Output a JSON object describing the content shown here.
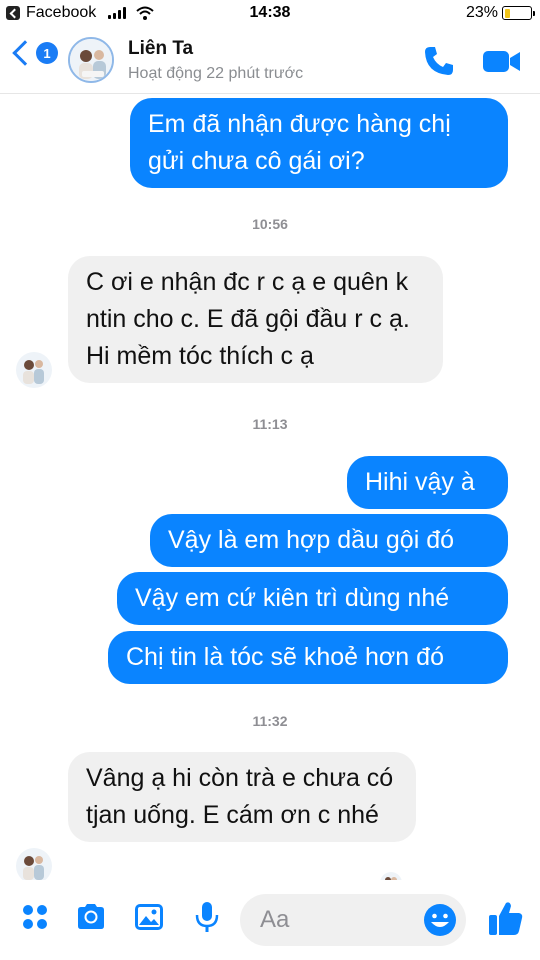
{
  "status_bar": {
    "back_app": "Facebook",
    "time": "14:38",
    "battery": "23%",
    "battery_level": 0.23
  },
  "header": {
    "back_badge": "1",
    "name": "Liên Ta",
    "active_status": "Hoạt động 22 phút trước"
  },
  "messages": [
    {
      "type": "out",
      "text": "Em đã nhận được hàng chị gửi chưa cô gái ơi?"
    },
    {
      "type": "time",
      "text": "10:56"
    },
    {
      "type": "in",
      "text": "C ơi e nhận đc r c ạ e quên k ntin cho c. E đã gội đầu r c ạ. Hi mềm tóc thích c ạ"
    },
    {
      "type": "time",
      "text": "11:13"
    },
    {
      "type": "out",
      "text": "Hihi vậy à"
    },
    {
      "type": "out",
      "text": "Vậy là em hợp dầu gội đó"
    },
    {
      "type": "out",
      "text": "Vậy em cứ kiên trì dùng nhé"
    },
    {
      "type": "out",
      "text": "Chị tin là tóc sẽ khoẻ hơn đó"
    },
    {
      "type": "time",
      "text": "11:32"
    },
    {
      "type": "in",
      "text": "Vâng ạ hi còn trà e chưa có tjan uống. E cám ơn c nhé"
    }
  ],
  "composer": {
    "placeholder": "Aa",
    "icons": [
      "apps-icon",
      "camera-icon",
      "image-icon",
      "microphone-icon",
      "emoji-icon",
      "thumbs-up-icon"
    ]
  },
  "colors": {
    "accent": "#0a84ff",
    "incoming_bubble": "#f0f0f0",
    "battery_fill": "#f0c419"
  }
}
